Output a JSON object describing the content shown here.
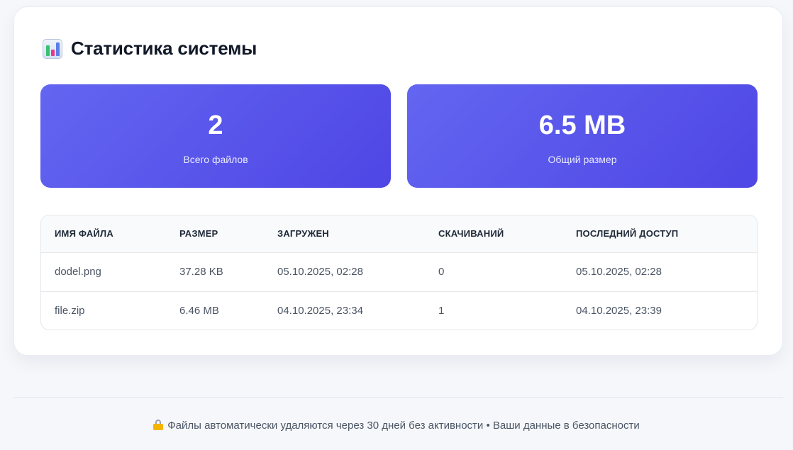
{
  "header": {
    "icon": "bar-chart-icon",
    "title": "Статистика системы"
  },
  "stats": {
    "total_files": {
      "value": "2",
      "label": "Всего файлов"
    },
    "total_size": {
      "value": "6.5 MB",
      "label": "Общий размер"
    }
  },
  "table": {
    "columns": [
      "ИМЯ ФАЙЛА",
      "РАЗМЕР",
      "ЗАГРУЖЕН",
      "СКАЧИВАНИЙ",
      "ПОСЛЕДНИЙ ДОСТУП"
    ],
    "rows": [
      {
        "name": "dodel.png",
        "size": "37.28 KB",
        "uploaded": "05.10.2025, 02:28",
        "downloads": "0",
        "last_access": "05.10.2025, 02:28"
      },
      {
        "name": "file.zip",
        "size": "6.46 MB",
        "uploaded": "04.10.2025, 23:34",
        "downloads": "1",
        "last_access": "04.10.2025, 23:39"
      }
    ]
  },
  "footer": {
    "icon": "lock-icon",
    "text": "Файлы автоматически удаляются через 30 дней без активности • Ваши данные в безопасности"
  },
  "colors": {
    "accent_start": "#6366f1",
    "accent_end": "#4f46e5",
    "background": "#f5f7fb"
  }
}
